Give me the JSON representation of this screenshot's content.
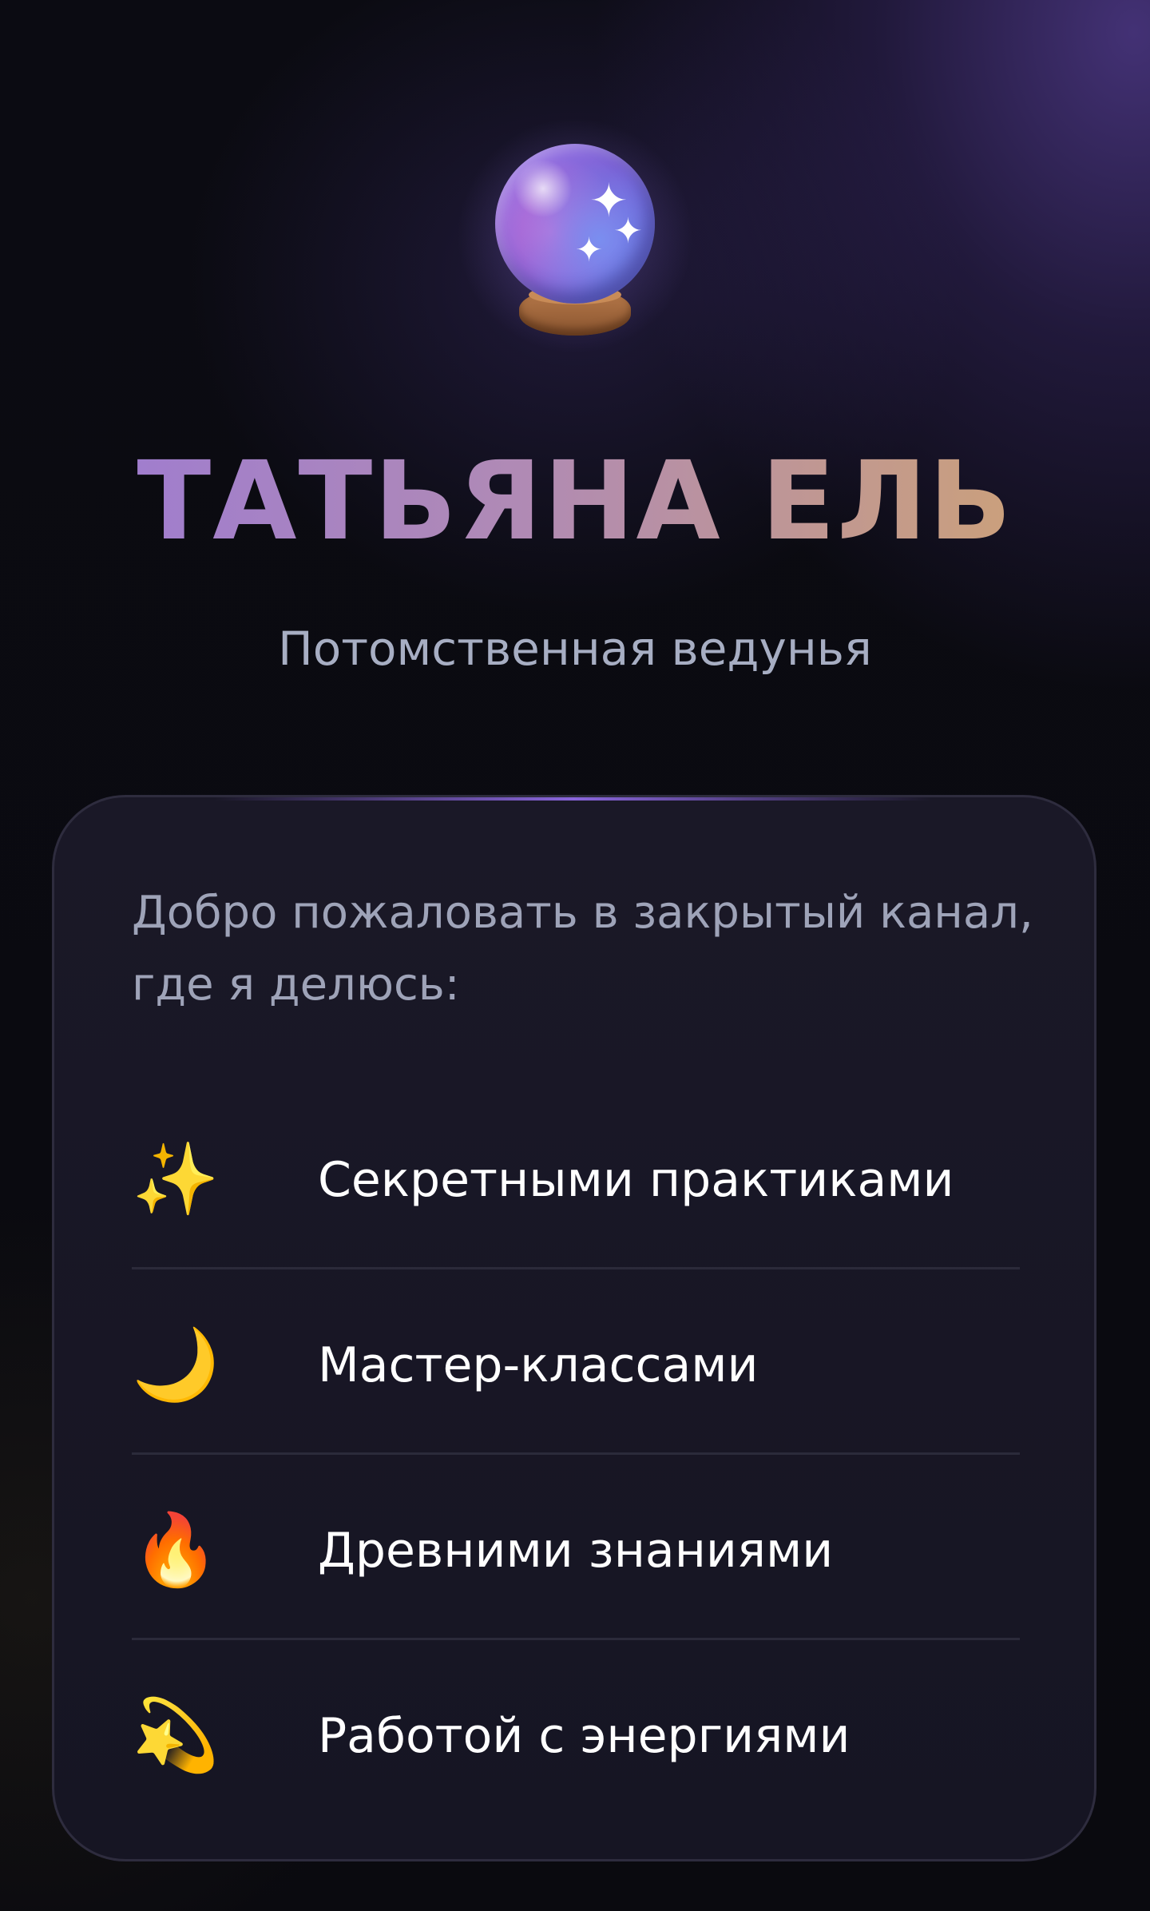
{
  "header": {
    "logo_icon": "crystal-ball-icon",
    "title": "ТАТЬЯНА ЕЛЬ",
    "subtitle": "Потомственная ведунья"
  },
  "card": {
    "intro": "Добро пожаловать в закрытый канал, где я делюсь:",
    "items": [
      {
        "icon": "sparkles-icon",
        "glyph": "✨",
        "label": "Секретными практиками"
      },
      {
        "icon": "crescent-moon-icon",
        "glyph": "🌙",
        "label": "Мастер-классами"
      },
      {
        "icon": "fire-icon",
        "glyph": "🔥",
        "label": "Древними знаниями"
      },
      {
        "icon": "dizzy-star-icon",
        "glyph": "💫",
        "label": "Работой с энергиями"
      }
    ]
  },
  "colors": {
    "background": "#0a0a0f",
    "accent_purple": "#9b79d6",
    "accent_gold": "#d2a66c",
    "card_bg": "#1a1827",
    "subtitle": "#a7aec3"
  }
}
